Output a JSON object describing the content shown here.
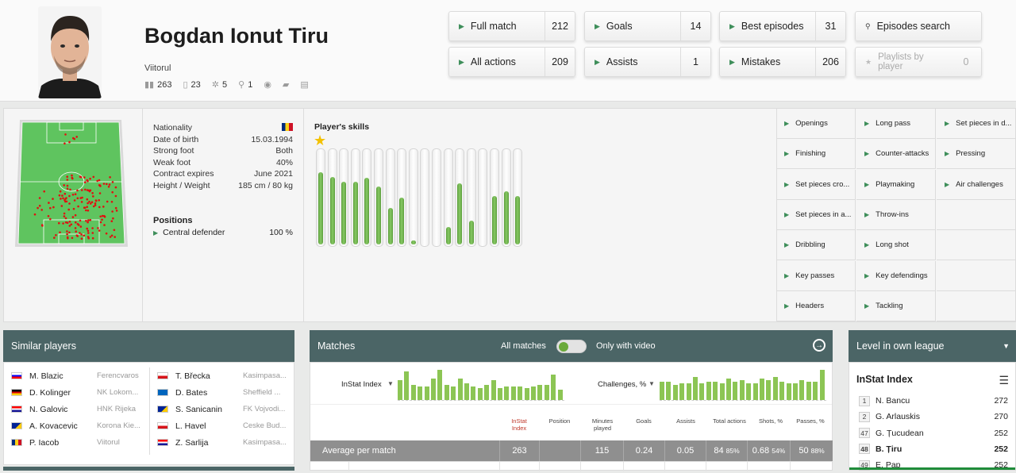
{
  "player": {
    "name": "Bogdan Ionut Tiru",
    "team": "Viitorul",
    "stats": [
      {
        "icon": "matches-chart-icon",
        "value": "263"
      },
      {
        "icon": "minutes-icon",
        "value": "23"
      },
      {
        "icon": "goals-ball-icon",
        "value": "5"
      },
      {
        "icon": "assists-icon",
        "value": "1"
      }
    ]
  },
  "header_buttons": [
    {
      "label": "Full match",
      "count": "212"
    },
    {
      "label": "Goals",
      "count": "14"
    },
    {
      "label": "Best episodes",
      "count": "31"
    },
    {
      "label": "Episodes search",
      "count": ""
    },
    {
      "label": "All actions",
      "count": "209"
    },
    {
      "label": "Assists",
      "count": "1"
    },
    {
      "label": "Mistakes",
      "count": "206"
    },
    {
      "label": "Playlists by player",
      "count": "0"
    }
  ],
  "info": [
    {
      "label": "Nationality",
      "value": ""
    },
    {
      "label": "Date of birth",
      "value": "15.03.1994"
    },
    {
      "label": "Strong foot",
      "value": "Both"
    },
    {
      "label": "Weak foot",
      "value": "40%"
    },
    {
      "label": "Contract expires",
      "value": "June 2021"
    },
    {
      "label": "Height / Weight",
      "value": "185 cm / 80 kg"
    }
  ],
  "positions": {
    "title": "Positions",
    "items": [
      {
        "label": "Central defender",
        "value": "100 %"
      }
    ]
  },
  "skills": {
    "title": "Player's skills",
    "levels": [
      0.77,
      0.72,
      0.67,
      0.67,
      0.71,
      0.62,
      0.39,
      0.5,
      0.04,
      0.0,
      0.0,
      0.19,
      0.65,
      0.25,
      0.0,
      0.52,
      0.57,
      0.52
    ]
  },
  "categories": [
    [
      "Openings",
      "Long pass",
      "Set pieces in d..."
    ],
    [
      "Finishing",
      "Counter-attacks",
      "Pressing"
    ],
    [
      "Set pieces cro...",
      "Playmaking",
      "Air challenges"
    ],
    [
      "Set pieces in a...",
      "Throw-ins",
      ""
    ],
    [
      "Dribbling",
      "Long shot",
      ""
    ],
    [
      "Key passes",
      "Key defendings",
      ""
    ],
    [
      "Headers",
      "Tackling",
      ""
    ]
  ],
  "similar": {
    "title": "Similar players",
    "left": [
      {
        "name": "M. Blazic",
        "club": "Ferencvaros",
        "flag": "slovenia"
      },
      {
        "name": "D. Kolinger",
        "club": "NK Lokom...",
        "flag": "germany"
      },
      {
        "name": "N. Galovic",
        "club": "HNK Rijeka",
        "flag": "croatia"
      },
      {
        "name": "A. Kovacevic",
        "club": "Korona Kie...",
        "flag": "bosnia"
      },
      {
        "name": "P. Iacob",
        "club": "Viitorul",
        "flag": "romania"
      }
    ],
    "right": [
      {
        "name": "T. Břecka",
        "club": "Kasimpasa...",
        "flag": "czech"
      },
      {
        "name": "D. Bates",
        "club": "Sheffield ...",
        "flag": "scotland"
      },
      {
        "name": "S. Sanicanin",
        "club": "FK Vojvodi...",
        "flag": "bosnia"
      },
      {
        "name": "L. Havel",
        "club": "Ceske Bud...",
        "flag": "czech"
      },
      {
        "name": "Z. Sarlija",
        "club": "Kasimpasa...",
        "flag": "croatia"
      }
    ]
  },
  "matches": {
    "title": "Matches",
    "all_label": "All matches",
    "video_label": "Only with video",
    "index_label": "InStat Index",
    "challenges_label": "Challenges, %",
    "index_bars": [
      0.65,
      0.95,
      0.5,
      0.45,
      0.45,
      0.7,
      1.0,
      0.5,
      0.45,
      0.7,
      0.55,
      0.45,
      0.4,
      0.5,
      0.65,
      0.4,
      0.45,
      0.45,
      0.45,
      0.4,
      0.45,
      0.5,
      0.5,
      0.85,
      0.35
    ],
    "chal_bars": [
      0.6,
      0.6,
      0.5,
      0.55,
      0.55,
      0.75,
      0.55,
      0.6,
      0.6,
      0.55,
      0.7,
      0.6,
      0.65,
      0.55,
      0.55,
      0.7,
      0.65,
      0.75,
      0.6,
      0.55,
      0.55,
      0.65,
      0.6,
      0.6,
      1.0
    ],
    "columns": [
      "InStat Index",
      "Position",
      "Minutes played",
      "Goals",
      "Assists",
      "Total actions",
      "Shots, %",
      "Passes, %"
    ],
    "avg_label": "Average per match",
    "avg": {
      "index": "263",
      "minutes": "115",
      "goals": "0.24",
      "assists": "0.05",
      "actions": "84",
      "actions_pct": "85%",
      "shots": "0.68",
      "shots_pct": "54%",
      "passes": "50",
      "passes_pct": "88%"
    }
  },
  "level": {
    "title": "Level in own league",
    "subtitle": "InStat Index",
    "rows": [
      {
        "rank": "1",
        "name": "N. Bancu",
        "value": "272",
        "bold": false
      },
      {
        "rank": "2",
        "name": "G. Arlauskis",
        "value": "270",
        "bold": false
      },
      {
        "rank": "47",
        "name": "G. Țucudean",
        "value": "252",
        "bold": false
      },
      {
        "rank": "48",
        "name": "B. Țiru",
        "value": "252",
        "bold": true
      },
      {
        "rank": "49",
        "name": "E. Pap",
        "value": "252",
        "bold": false
      }
    ]
  }
}
